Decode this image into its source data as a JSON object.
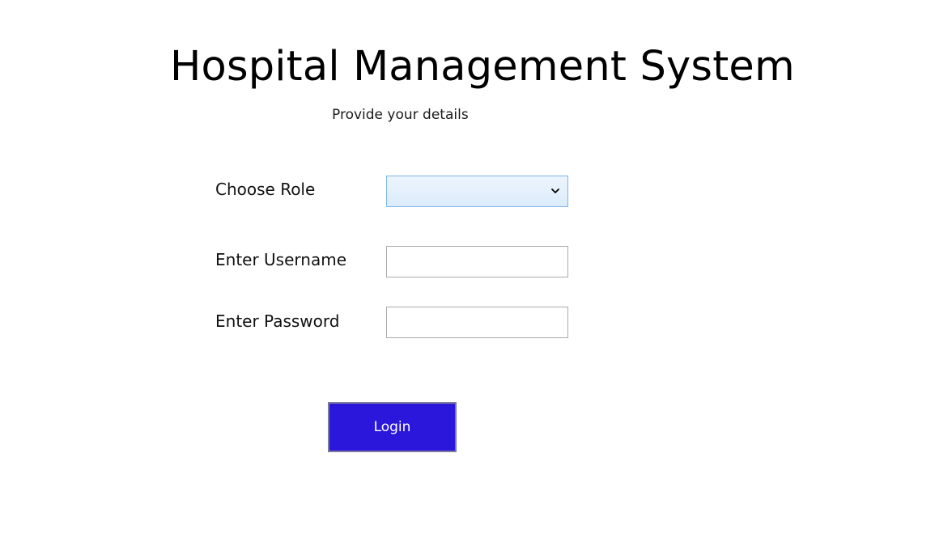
{
  "page": {
    "title": "Hospital Management System",
    "subtitle": "Provide your details"
  },
  "form": {
    "role": {
      "label": "Choose Role",
      "selected_value": "",
      "icon": "chevron-down-icon"
    },
    "username": {
      "label": "Enter Username",
      "value": ""
    },
    "password": {
      "label": "Enter Password",
      "value": ""
    },
    "login_label": "Login"
  },
  "colors": {
    "login_button": "#2b17db",
    "role_select_border": "#7eb4ea",
    "role_select_background": "#dcecfc",
    "field_border": "#ababab"
  }
}
